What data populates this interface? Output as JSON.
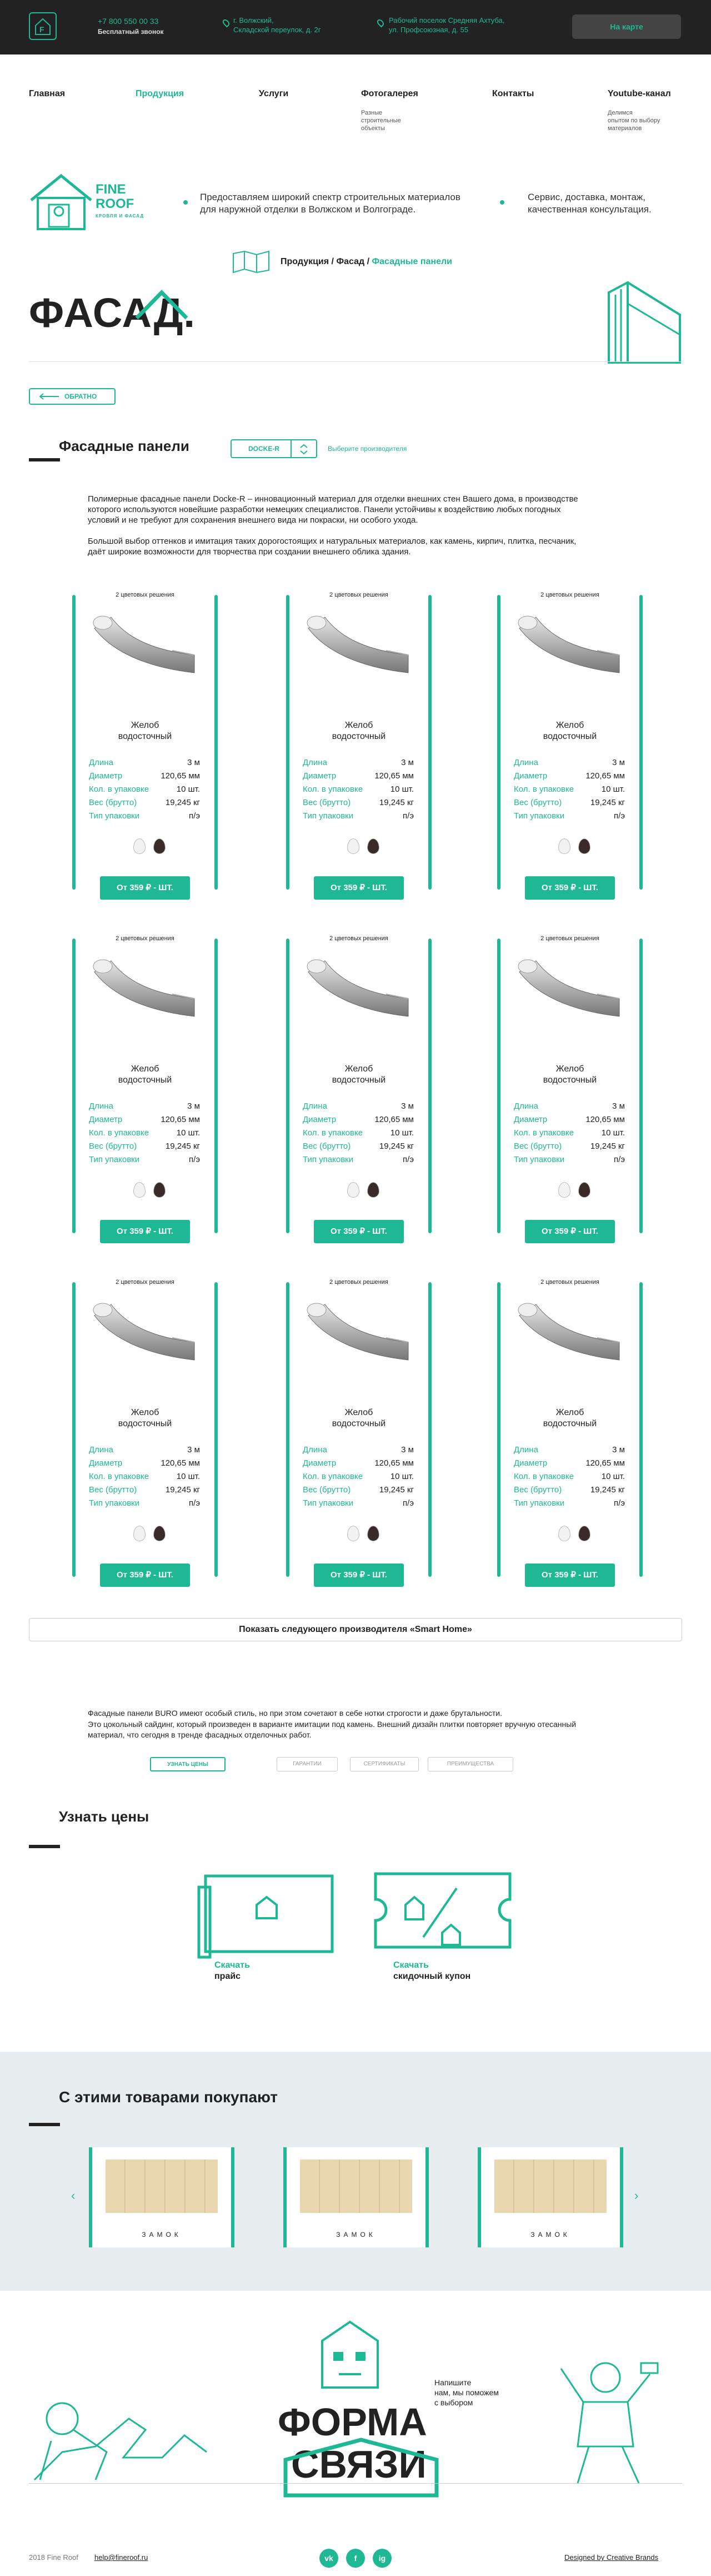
{
  "header": {
    "logo_letter": "F",
    "phone": "+7 800 550 00 33",
    "phone_sub": "Бесплатный звонок",
    "address1": [
      "г. Волжский,",
      "Складской переулок, д. 2г"
    ],
    "address2": [
      "Рабочий поселок Средняя Ахтуба,",
      "ул. Профсоюзная, д. 55"
    ],
    "map_button": "На карте"
  },
  "nav": {
    "items": [
      {
        "label": "Главная"
      },
      {
        "label": "Продукция"
      },
      {
        "label": "Услуги"
      },
      {
        "label": "Фотогалерея",
        "sub": [
          "Разные",
          "строительные",
          "объекты"
        ]
      },
      {
        "label": "Контакты"
      },
      {
        "label": "Youtube-канал",
        "sub": [
          "Делимся",
          "опытом по выбору",
          "материалов"
        ]
      }
    ],
    "active_index": 1
  },
  "brand": {
    "name_line1": "FINE",
    "name_line2": "ROOF",
    "name_sub": "КРОВЛЯ И ФАСАД",
    "tagline1": [
      "Предоставляем широкий спектр строительных материалов",
      "для наружной отделки в Волжском и Волгограде."
    ],
    "tagline2": [
      "Сервис, доставка, монтаж,",
      "качественная консультация."
    ]
  },
  "breadcrumb": {
    "part1": "Продукция / Фасад / ",
    "current": "Фасадные панели"
  },
  "page_heading": "ФАСАД.",
  "back_button": "ОБРАТНО",
  "section": {
    "title": "Фасадные панели",
    "manufacturer": "DOCKE-R",
    "choose_link": "Выберите производителя",
    "intro1": "Полимерные фасадные панели Docke-R – инновационный материал для отделки внешних стен Вашего дома, в производстве которого используются новейшие разработки немецких специалистов. Панели устойчивы к воздействию любых погодных условий и не требуют для сохранения внешнего вида ни покраски, ни особого ухода.",
    "intro2": "Большой выбор оттенков и имитация таких дорогостоящих и натуральных материалов, как камень, кирпич, плитка, песчаник, даёт широкие возможности для творчества при создании внешнего облика здания."
  },
  "products": [
    {
      "caption": "2 цветовых решения",
      "name": [
        "Желоб",
        "водосточный"
      ],
      "specs": [
        [
          "Длина",
          "3 м"
        ],
        [
          "Диаметр",
          "120,65 мм"
        ],
        [
          "Кол. в упаковке",
          "10 шт."
        ],
        [
          "Вес (брутто)",
          "19,245 кг"
        ],
        [
          "Тип упаковки",
          "п/э"
        ]
      ],
      "colors": [
        "#f2f2f2",
        "#3a2a2a"
      ],
      "price": "От 359 ₽ - ШТ."
    },
    {
      "caption": "2 цветовых решения",
      "name": [
        "Желоб",
        "водосточный"
      ],
      "specs": [
        [
          "Длина",
          "3 м"
        ],
        [
          "Диаметр",
          "120,65 мм"
        ],
        [
          "Кол. в упаковке",
          "10 шт."
        ],
        [
          "Вес (брутто)",
          "19,245 кг"
        ],
        [
          "Тип упаковки",
          "п/э"
        ]
      ],
      "colors": [
        "#f2f2f2",
        "#3a2a2a"
      ],
      "price": "От 359 ₽ - ШТ."
    },
    {
      "caption": "2 цветовых решения",
      "name": [
        "Желоб",
        "водосточный"
      ],
      "specs": [
        [
          "Длина",
          "3 м"
        ],
        [
          "Диаметр",
          "120,65 мм"
        ],
        [
          "Кол. в упаковке",
          "10 шт."
        ],
        [
          "Вес (брутто)",
          "19,245 кг"
        ],
        [
          "Тип упаковки",
          "п/э"
        ]
      ],
      "colors": [
        "#f2f2f2",
        "#3a2a2a"
      ],
      "price": "От 359 ₽ - ШТ."
    },
    {
      "caption": "2 цветовых решения",
      "name": [
        "Желоб",
        "водосточный"
      ],
      "specs": [
        [
          "Длина",
          "3 м"
        ],
        [
          "Диаметр",
          "120,65 мм"
        ],
        [
          "Кол. в упаковке",
          "10 шт."
        ],
        [
          "Вес (брутто)",
          "19,245 кг"
        ],
        [
          "Тип упаковки",
          "п/э"
        ]
      ],
      "colors": [
        "#f2f2f2",
        "#3a2a2a"
      ],
      "price": "От 359 ₽ - ШТ."
    },
    {
      "caption": "2 цветовых решения",
      "name": [
        "Желоб",
        "водосточный"
      ],
      "specs": [
        [
          "Длина",
          "3 м"
        ],
        [
          "Диаметр",
          "120,65 мм"
        ],
        [
          "Кол. в упаковке",
          "10 шт."
        ],
        [
          "Вес (брутто)",
          "19,245 кг"
        ],
        [
          "Тип упаковки",
          "п/э"
        ]
      ],
      "colors": [
        "#f2f2f2",
        "#3a2a2a"
      ],
      "price": "От 359 ₽ - ШТ."
    },
    {
      "caption": "2 цветовых решения",
      "name": [
        "Желоб",
        "водосточный"
      ],
      "specs": [
        [
          "Длина",
          "3 м"
        ],
        [
          "Диаметр",
          "120,65 мм"
        ],
        [
          "Кол. в упаковке",
          "10 шт."
        ],
        [
          "Вес (брутто)",
          "19,245 кг"
        ],
        [
          "Тип упаковки",
          "п/э"
        ]
      ],
      "colors": [
        "#f2f2f2",
        "#3a2a2a"
      ],
      "price": "От 359 ₽ - ШТ."
    },
    {
      "caption": "2 цветовых решения",
      "name": [
        "Желоб",
        "водосточный"
      ],
      "specs": [
        [
          "Длина",
          "3 м"
        ],
        [
          "Диаметр",
          "120,65 мм"
        ],
        [
          "Кол. в упаковке",
          "10 шт."
        ],
        [
          "Вес (брутто)",
          "19,245 кг"
        ],
        [
          "Тип упаковки",
          "п/э"
        ]
      ],
      "colors": [
        "#f2f2f2",
        "#3a2a2a"
      ],
      "price": "От 359 ₽ - ШТ."
    },
    {
      "caption": "2 цветовых решения",
      "name": [
        "Желоб",
        "водосточный"
      ],
      "specs": [
        [
          "Длина",
          "3 м"
        ],
        [
          "Диаметр",
          "120,65 мм"
        ],
        [
          "Кол. в упаковке",
          "10 шт."
        ],
        [
          "Вес (брутто)",
          "19,245 кг"
        ],
        [
          "Тип упаковки",
          "п/э"
        ]
      ],
      "colors": [
        "#f2f2f2",
        "#3a2a2a"
      ],
      "price": "От 359 ₽ - ШТ."
    },
    {
      "caption": "2 цветовых решения",
      "name": [
        "Желоб",
        "водосточный"
      ],
      "specs": [
        [
          "Длина",
          "3 м"
        ],
        [
          "Диаметр",
          "120,65 мм"
        ],
        [
          "Кол. в упаковке",
          "10 шт."
        ],
        [
          "Вес (брутто)",
          "19,245 кг"
        ],
        [
          "Тип упаковки",
          "п/э"
        ]
      ],
      "colors": [
        "#f2f2f2",
        "#3a2a2a"
      ],
      "price": "От 359 ₽ - ШТ."
    }
  ],
  "next_manufacturer": "Показать следующего производителя «Smart Home»",
  "about": {
    "text1": "Фасадные панели BURO имеют особый стиль, но при этом сочетают в себе нотки строгости и даже брутальности.",
    "text2": "Это цокольный сайдинг, который произведен в варианте имитации под камень. Внешний дизайн плитки повторяет вручную отесанный материал, что сегодня в тренде фасадных отделочных работ.",
    "tabs": [
      "УЗНАТЬ ЦЕНЫ",
      "ГАРАНТИИ",
      "СЕРТИФИКАТЫ",
      "ПРЕИМУЩЕСТВА"
    ]
  },
  "prices": {
    "title": "Узнать цены",
    "download1": [
      "Скачать",
      "прайс"
    ],
    "download2": [
      "Скачать",
      "скидочный купон"
    ]
  },
  "recommend": {
    "title": "С этими товарами покупают",
    "items": [
      "ЗАМОК",
      "ЗАМОК",
      "ЗАМОК"
    ]
  },
  "contact_form": {
    "word1": "ФОРМА",
    "word2": "СВЯЗИ",
    "bubble": [
      "Напишите",
      "нам, мы поможем",
      "с выбором"
    ]
  },
  "footer": {
    "copyright": "2018 Fine Roof",
    "email": "help@fineroof.ru",
    "social": [
      "vk",
      "f",
      "ig"
    ],
    "credit": "Designed by Creative Brands"
  },
  "colors": {
    "accent": "#1fb894",
    "dark": "#222222",
    "light_bg": "#e8eef0"
  }
}
